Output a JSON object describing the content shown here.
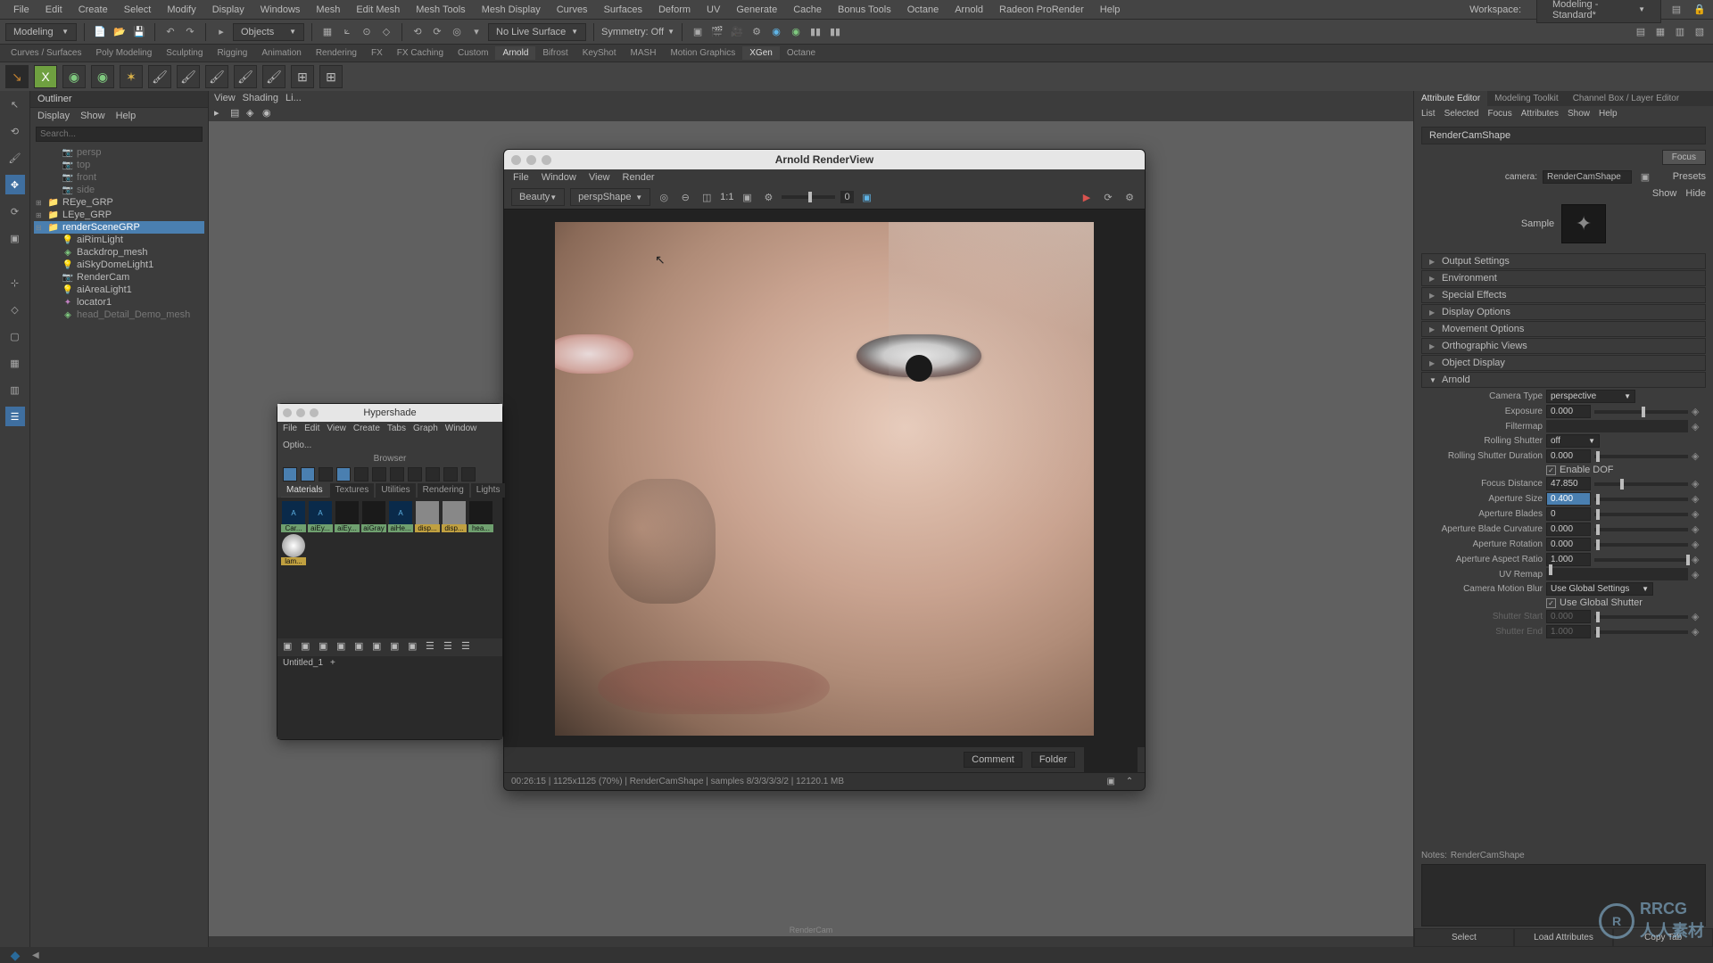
{
  "menubar": [
    "File",
    "Edit",
    "Create",
    "Select",
    "Modify",
    "Display",
    "Windows",
    "Mesh",
    "Edit Mesh",
    "Mesh Tools",
    "Mesh Display",
    "Curves",
    "Surfaces",
    "Deform",
    "UV",
    "Generate",
    "Cache",
    "Bonus Tools",
    "Octane",
    "Arnold",
    "Radeon ProRender",
    "Help"
  ],
  "workspace_label": "Workspace:",
  "workspace_value": "Modeling - Standard*",
  "module_dropdown": "Modeling",
  "mask_dropdown": "Objects",
  "surface_mode": "No Live Surface",
  "symmetry_label": "Symmetry: Off",
  "shelf_tabs": [
    "Curves / Surfaces",
    "Poly Modeling",
    "Sculpting",
    "Rigging",
    "Animation",
    "Rendering",
    "FX",
    "FX Caching",
    "Custom",
    "Arnold",
    "Bifrost",
    "KeyShot",
    "MASH",
    "Motion Graphics",
    "XGen",
    "Octane"
  ],
  "outliner": {
    "title": "Outliner",
    "menu": [
      "Display",
      "Show",
      "Help"
    ],
    "search_placeholder": "Search...",
    "items": [
      {
        "label": "persp",
        "type": "cam",
        "indent": 1,
        "hidden": true
      },
      {
        "label": "top",
        "type": "cam",
        "indent": 1,
        "hidden": true
      },
      {
        "label": "front",
        "type": "cam",
        "indent": 1,
        "hidden": true
      },
      {
        "label": "side",
        "type": "cam",
        "indent": 1,
        "hidden": true
      },
      {
        "label": "REye_GRP",
        "type": "grp",
        "indent": 0,
        "exp": "+"
      },
      {
        "label": "LEye_GRP",
        "type": "grp",
        "indent": 0,
        "exp": "+"
      },
      {
        "label": "renderSceneGRP",
        "type": "grp",
        "indent": 0,
        "exp": "-",
        "sel": true
      },
      {
        "label": "aiRimLight",
        "type": "light",
        "indent": 1
      },
      {
        "label": "Backdrop_mesh",
        "type": "mesh",
        "indent": 1
      },
      {
        "label": "aiSkyDomeLight1",
        "type": "light",
        "indent": 1
      },
      {
        "label": "RenderCam",
        "type": "cam",
        "indent": 1
      },
      {
        "label": "aiAreaLight1",
        "type": "light",
        "indent": 1
      },
      {
        "label": "locator1",
        "type": "loc",
        "indent": 1
      },
      {
        "label": "head_Detail_Demo_mesh",
        "type": "mesh",
        "indent": 1,
        "hidden": true
      }
    ]
  },
  "viewport_menu": [
    "View",
    "Shading",
    "Li..."
  ],
  "render_view": {
    "title": "Arnold RenderView",
    "menu": [
      "File",
      "Window",
      "View",
      "Render"
    ],
    "aov": "Beauty",
    "camera": "perspShape",
    "ratio": "1:1",
    "exposure_val": "0",
    "comment": "Comment",
    "folder": "Folder",
    "status": "00:26:15 | 1125x1125 (70%) | RenderCamShape | samples 8/3/3/3/3/2 | 12120.1 MB"
  },
  "hypershade": {
    "title": "Hypershade",
    "menu": [
      "File",
      "Edit",
      "View",
      "Create",
      "Tabs",
      "Graph",
      "Window",
      "Optio..."
    ],
    "browser": "Browser",
    "tabs": [
      "Materials",
      "Textures",
      "Utilities",
      "Rendering",
      "Lights"
    ],
    "swatches": [
      {
        "l": "Car...",
        "c": "blue"
      },
      {
        "l": "aiEy...",
        "c": "blue"
      },
      {
        "l": "aiEy...",
        "c": "dark"
      },
      {
        "l": "aiGray",
        "c": "dark"
      },
      {
        "l": "aiHe...",
        "c": "blue"
      },
      {
        "l": "disp...",
        "c": "grey"
      },
      {
        "l": "disp...",
        "c": "grey"
      },
      {
        "l": "hea...",
        "c": "dark"
      },
      {
        "l": "lam...",
        "c": "white"
      }
    ],
    "footer_tab": "Untitled_1"
  },
  "attribute_editor": {
    "tabs": [
      "Attribute Editor",
      "Modeling Toolkit",
      "Channel Box / Layer Editor"
    ],
    "menu": [
      "List",
      "Selected",
      "Focus",
      "Attributes",
      "Show",
      "Help"
    ],
    "node_tab": "RenderCamShape",
    "actions": [
      "Focus",
      "Presets"
    ],
    "show_hide": [
      "Show",
      "Hide"
    ],
    "camera_label": "camera:",
    "camera_value": "RenderCamShape",
    "sample": "Sample",
    "sections_closed": [
      "Output Settings",
      "Environment",
      "Special Effects",
      "Display Options",
      "Movement Options",
      "Orthographic Views",
      "Object Display"
    ],
    "section_open": "Arnold",
    "attrs": {
      "camera_type": {
        "label": "Camera Type",
        "value": "perspective"
      },
      "exposure": {
        "label": "Exposure",
        "value": "0.000",
        "thumb": 50
      },
      "filtermap": {
        "label": "Filtermap"
      },
      "rolling_shutter": {
        "label": "Rolling Shutter",
        "value": "off"
      },
      "rolling_shutter_dur": {
        "label": "Rolling Shutter Duration",
        "value": "0.000",
        "thumb": 2
      },
      "enable_dof": {
        "label": "Enable DOF",
        "checked": true
      },
      "focus_distance": {
        "label": "Focus Distance",
        "value": "47.850",
        "thumb": 28
      },
      "aperture_size": {
        "label": "Aperture Size",
        "value": "0.400",
        "sel": true,
        "thumb": 2
      },
      "aperture_blades": {
        "label": "Aperture Blades",
        "value": "0",
        "thumb": 2
      },
      "aperture_blade_curv": {
        "label": "Aperture Blade Curvature",
        "value": "0.000",
        "thumb": 2
      },
      "aperture_rotation": {
        "label": "Aperture Rotation",
        "value": "0.000",
        "thumb": 2
      },
      "aperture_aspect": {
        "label": "Aperture Aspect Ratio",
        "value": "1.000",
        "thumb": 98
      },
      "uv_remap": {
        "label": "UV Remap",
        "thumb": 2
      },
      "camera_motion_blur": {
        "label": "Camera Motion Blur",
        "value": "Use Global Settings"
      },
      "use_global_shutter": {
        "label": "Use Global Shutter",
        "checked": true
      },
      "shutter_start": {
        "label": "Shutter Start",
        "value": "0.000",
        "thumb": 2,
        "disabled": true
      },
      "shutter_end": {
        "label": "Shutter End",
        "value": "1.000",
        "thumb": 2,
        "disabled": true
      }
    },
    "notes_label": "Notes:",
    "notes_value": "RenderCamShape",
    "footer": [
      "Select",
      "Load Attributes",
      "Copy Tab"
    ]
  },
  "viewport_footer_label": "RenderCam",
  "watermark": "RRCG\n人人素材"
}
